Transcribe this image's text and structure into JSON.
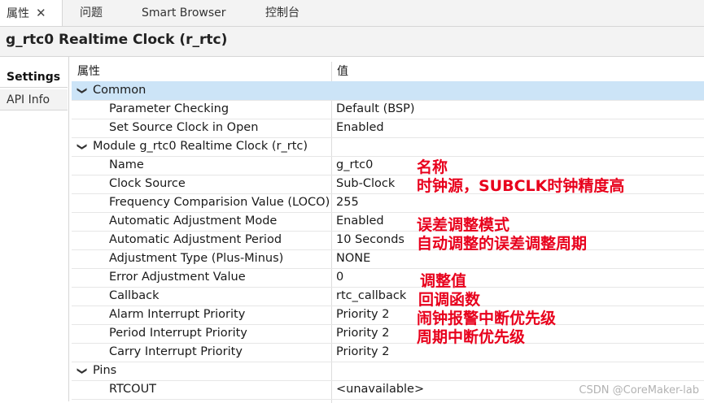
{
  "tabs": [
    {
      "label": "属性",
      "active": true
    },
    {
      "label": "问题",
      "active": false
    },
    {
      "label": "Smart Browser",
      "active": false
    },
    {
      "label": "控制台",
      "active": false
    }
  ],
  "title": "g_rtc0 Realtime Clock (r_rtc)",
  "side_tabs": [
    "Settings",
    "API Info"
  ],
  "columns": {
    "property": "属性",
    "value": "值"
  },
  "rows": [
    {
      "name": "Common",
      "value": "",
      "group": true
    },
    {
      "name": "Parameter Checking",
      "value": "Default (BSP)"
    },
    {
      "name": "Set Source Clock in Open",
      "value": "Enabled"
    },
    {
      "name": "Module g_rtc0 Realtime Clock (r_rtc)",
      "value": "",
      "group": true
    },
    {
      "name": "Name",
      "value": "g_rtc0"
    },
    {
      "name": "Clock Source",
      "value": "Sub-Clock"
    },
    {
      "name": "Frequency Comparision Value (LOCO)",
      "value": "255"
    },
    {
      "name": "Automatic Adjustment Mode",
      "value": "Enabled"
    },
    {
      "name": "Automatic Adjustment Period",
      "value": "10 Seconds"
    },
    {
      "name": "Adjustment Type (Plus-Minus)",
      "value": "NONE"
    },
    {
      "name": "Error Adjustment Value",
      "value": "0"
    },
    {
      "name": "Callback",
      "value": "rtc_callback"
    },
    {
      "name": "Alarm Interrupt Priority",
      "value": "Priority 2"
    },
    {
      "name": "Period Interrupt Priority",
      "value": "Priority 2"
    },
    {
      "name": "Carry Interrupt Priority",
      "value": "Priority 2"
    },
    {
      "name": "Pins",
      "value": "",
      "group": true
    },
    {
      "name": "RTCOUT",
      "value": "<unavailable>"
    }
  ],
  "annotations": {
    "name": "名称",
    "clock_source": "时钟源，SUBCLK时钟精度高",
    "adjust_mode": "误差调整模式",
    "adjust_period": "自动调整的误差调整周期",
    "adjust_value": "调整值",
    "callback": "回调函数",
    "alarm_priority": "闹钟报警中断优先级",
    "period_priority": "周期中断优先级"
  },
  "watermark": "CSDN @CoreMaker-lab",
  "icons": {
    "close": "close-icon",
    "expand": "chevron-down-icon"
  },
  "colors": {
    "selection": "#cce4f7",
    "annotation": "#e8001c"
  }
}
